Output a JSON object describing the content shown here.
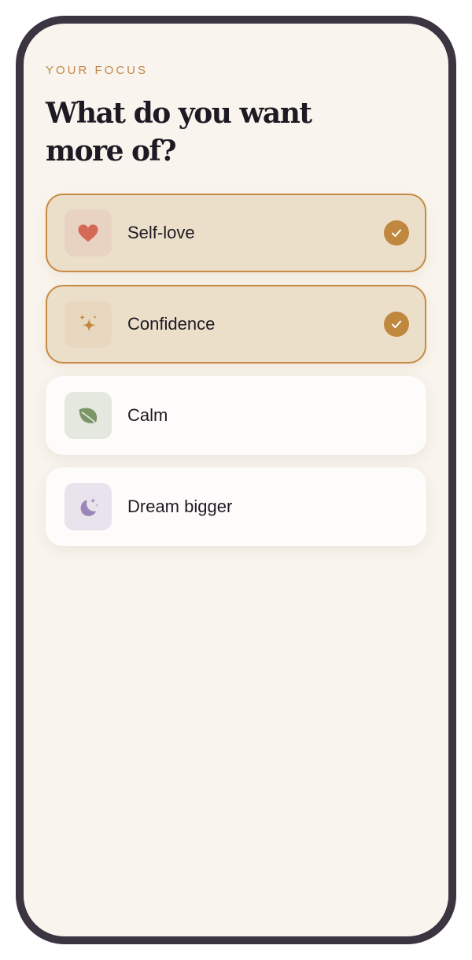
{
  "screen": {
    "eyebrow": "YOUR FOCUS",
    "title": "What do you want more of?"
  },
  "options": [
    {
      "label": "Self-love",
      "icon": "heart-icon",
      "selected": true,
      "icon_color": "#d46a56",
      "tile_color": "#e8d3c3"
    },
    {
      "label": "Confidence",
      "icon": "sparkle-icon",
      "selected": true,
      "icon_color": "#c4873f",
      "tile_color": "#e8d8bf"
    },
    {
      "label": "Calm",
      "icon": "leaf-icon",
      "selected": false,
      "icon_color": "#7a9566",
      "tile_color": "#e4e8df"
    },
    {
      "label": "Dream bigger",
      "icon": "moon-stars-icon",
      "selected": false,
      "icon_color": "#9a86b8",
      "tile_color": "#e8e3ec"
    }
  ],
  "colors": {
    "accent": "#c0873f",
    "background": "#f9f5ee",
    "frame": "#3a3540",
    "text": "#1e1a24"
  }
}
